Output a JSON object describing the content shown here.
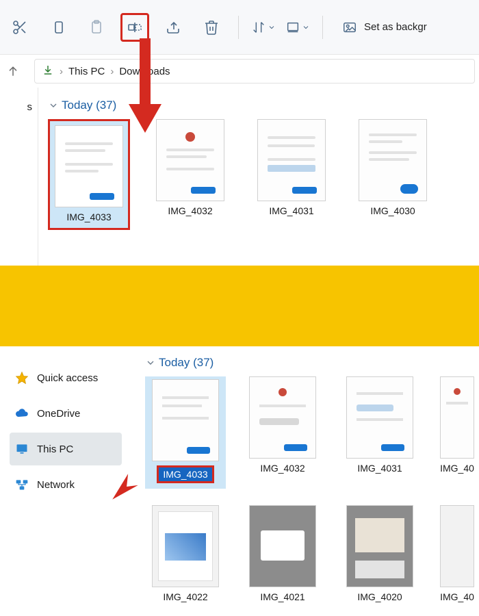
{
  "toolbar": {
    "cut_label": "Cut",
    "copy_label": "Copy",
    "paste_label": "Paste",
    "rename_label": "Rename",
    "share_label": "Share",
    "delete_label": "Delete",
    "sort_label": "Sort",
    "view_label": "View",
    "set_bg_label": "Set as backgr"
  },
  "breadcrumb": {
    "loc1": "This PC",
    "loc2": "Downloads"
  },
  "sidebar_letter": "s",
  "upper": {
    "group_label": "Today (37)",
    "items": [
      {
        "name": "IMG_4033",
        "selected": true
      },
      {
        "name": "IMG_4032",
        "selected": false
      },
      {
        "name": "IMG_4031",
        "selected": false
      },
      {
        "name": "IMG_4030",
        "selected": false
      }
    ]
  },
  "sidebar": {
    "items": [
      {
        "label": "Quick access",
        "icon": "star",
        "active": false
      },
      {
        "label": "OneDrive",
        "icon": "cloud",
        "active": false
      },
      {
        "label": "This PC",
        "icon": "monitor",
        "active": true
      },
      {
        "label": "Network",
        "icon": "network",
        "active": false
      }
    ]
  },
  "lower": {
    "group_label": "Today (37)",
    "items_row1": [
      {
        "name": "IMG_4033",
        "editing": true
      },
      {
        "name": "IMG_4032",
        "editing": false
      },
      {
        "name": "IMG_4031",
        "editing": false
      },
      {
        "name": "IMG_40",
        "editing": false
      }
    ],
    "items_row2": [
      {
        "name": "IMG_4022"
      },
      {
        "name": "IMG_4021"
      },
      {
        "name": "IMG_4020"
      },
      {
        "name": "IMG_40"
      }
    ]
  }
}
